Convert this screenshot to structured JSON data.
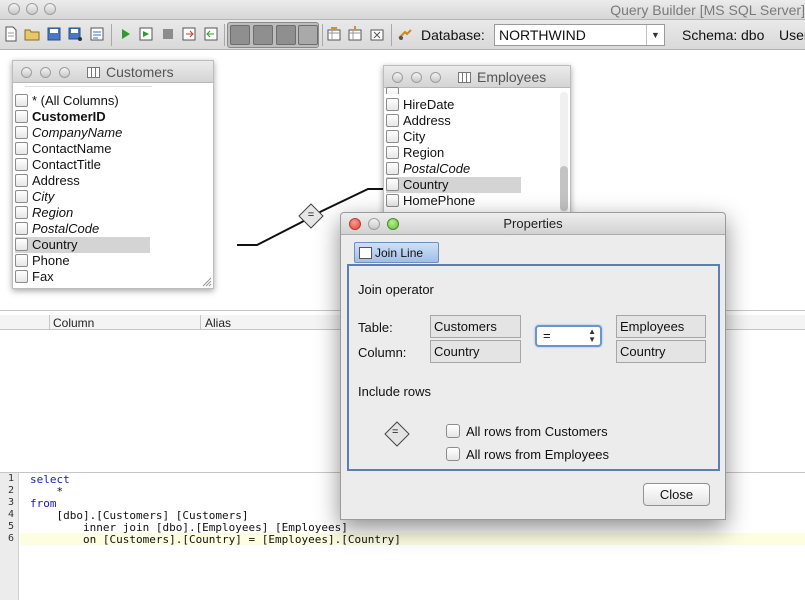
{
  "app": {
    "title": "Query Builder [MS SQL Server]"
  },
  "toolbar": {
    "icons": [
      "new-icon",
      "open-icon",
      "save-icon",
      "save-as-icon",
      "properties-icon",
      "run-icon",
      "run-step-icon",
      "stop-icon",
      "export-icon",
      "import-icon",
      "view-diagram-icon",
      "view-grid-icon",
      "view-text-icon",
      "view-split-icon",
      "add-table-icon",
      "add-derived-icon",
      "remove-icon",
      "connect-icon"
    ],
    "database_label": "Database:",
    "database_value": "NORTHWIND",
    "schema_label": "Schema:",
    "schema_value": "dbo",
    "user_label": "User"
  },
  "customers_table": {
    "name": "Customers",
    "columns": [
      "* (All Columns)",
      "CustomerID",
      "CompanyName",
      "ContactName",
      "ContactTitle",
      "Address",
      "City",
      "Region",
      "PostalCode",
      "Country",
      "Phone",
      "Fax"
    ]
  },
  "employees_table": {
    "name": "Employees",
    "columns": [
      "HireDate",
      "Address",
      "City",
      "Region",
      "PostalCode",
      "Country",
      "HomePhone"
    ]
  },
  "join_marker": "=",
  "grid": {
    "headers": [
      "Column",
      "Alias"
    ]
  },
  "sql": {
    "line_numbers": [
      "1",
      "2",
      "3",
      "4",
      "5",
      "6"
    ],
    "lines": [
      "select",
      "    *",
      "from",
      "    [dbo].[Customers] [Customers]",
      "        inner join [dbo].[Employees] [Employees]",
      "        on [Customers].[Country] = [Employees].[Country]"
    ]
  },
  "dialog": {
    "title": "Properties",
    "tab": "Join Line",
    "join_operator_label": "Join operator",
    "table_label": "Table:",
    "column_label": "Column:",
    "left_table": "Customers",
    "left_column": "Country",
    "operator": "=",
    "right_table": "Employees",
    "right_column": "Country",
    "include_rows_label": "Include rows",
    "include_marker": "=",
    "option_left": "All rows from Customers",
    "option_right": "All rows from Employees",
    "close_label": "Close"
  }
}
